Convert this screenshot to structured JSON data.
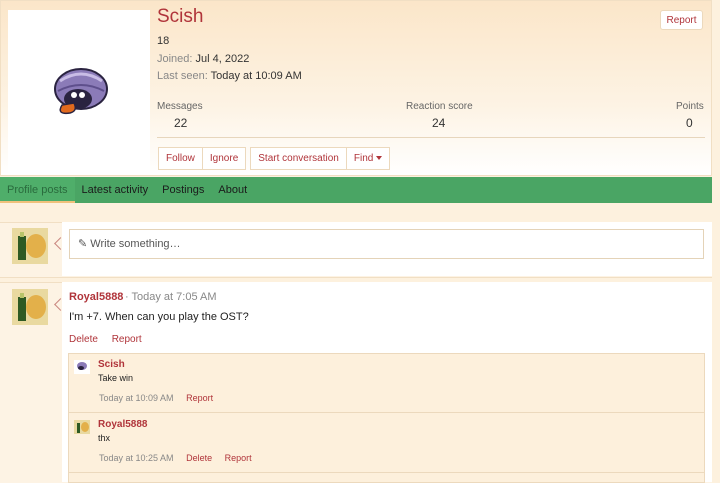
{
  "profile": {
    "username": "Scish",
    "age": "18",
    "joined_label": "Joined:",
    "joined_value": "Jul 4, 2022",
    "lastseen_label": "Last seen:",
    "lastseen_value": "Today at 10:09 AM",
    "report_label": "Report",
    "avatar_icon": "shellder-icon"
  },
  "stats": [
    {
      "label": "Messages",
      "value": "22"
    },
    {
      "label": "Reaction score",
      "value": "24"
    },
    {
      "label": "Points",
      "value": "0"
    }
  ],
  "actions": {
    "follow": "Follow",
    "ignore": "Ignore",
    "start_conversation": "Start conversation",
    "find": "Find"
  },
  "tabs": [
    {
      "label": "Profile posts",
      "active": true
    },
    {
      "label": "Latest activity",
      "active": false
    },
    {
      "label": "Postings",
      "active": false
    },
    {
      "label": "About",
      "active": false
    }
  ],
  "composer": {
    "placeholder": "Write something…",
    "icon": "pencil-icon"
  },
  "post": {
    "author": "Royal5888",
    "time": "· Today at 7:05 AM",
    "text": "I'm +7. When can you play the OST?",
    "delete_label": "Delete",
    "report_label": "Report"
  },
  "comments": [
    {
      "author": "Scish",
      "text": "Take win",
      "time": "Today at 10:09 AM",
      "report_label": "Report"
    },
    {
      "author": "Royal5888",
      "text": "thx",
      "time": "Today at 10:25 AM",
      "delete_label": "Delete",
      "report_label": "Report"
    }
  ],
  "colors": {
    "accent": "#b0343a",
    "tab_bar": "#4aa564",
    "page_bg": "#fdf1de"
  }
}
